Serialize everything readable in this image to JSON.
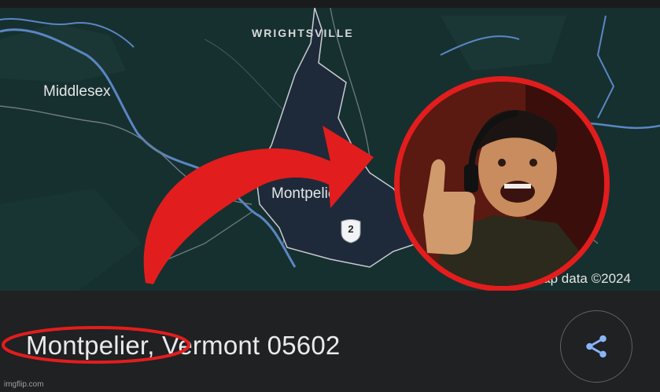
{
  "map": {
    "labels": {
      "wrightsville": "WRIGHTSVILLE",
      "middlesex": "Middlesex",
      "montpelier": "Montpelier"
    },
    "route_number": "2",
    "attribution": "Map data ©2024"
  },
  "place": {
    "address": "Montpelier, Vermont 05602"
  },
  "share_button": {
    "icon": "share-icon"
  },
  "watermark": "imgflip.com",
  "colors": {
    "map_background": "#16302f",
    "river": "#5a86c4",
    "city_fill": "#1e2a3a",
    "highlight_red": "#e21d1d",
    "share_blue": "#8ab4f8"
  }
}
